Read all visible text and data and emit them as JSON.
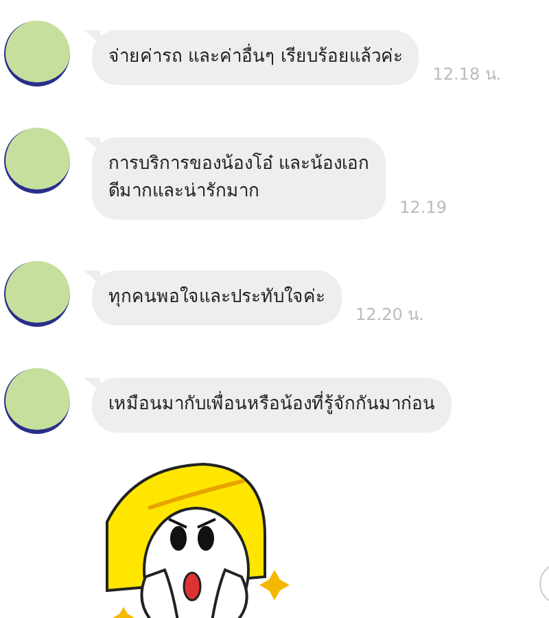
{
  "messages": [
    {
      "text": "จ่ายค่ารถ และค่าอื่นๆ เรียบร้อยแล้วค่ะ",
      "time": "12.18 น."
    },
    {
      "text": "การบริการของน้องโอ๋ และน้องเอก\nดีมากและน่ารักมาก",
      "time": "12.19"
    },
    {
      "text": "ทุกคนพอใจและประทับใจค่ะ",
      "time": "12.20 น."
    },
    {
      "text": "เหมือนมากับเพื่อนหรือน้องที่รู้จักกันมาก่อน"
    }
  ]
}
